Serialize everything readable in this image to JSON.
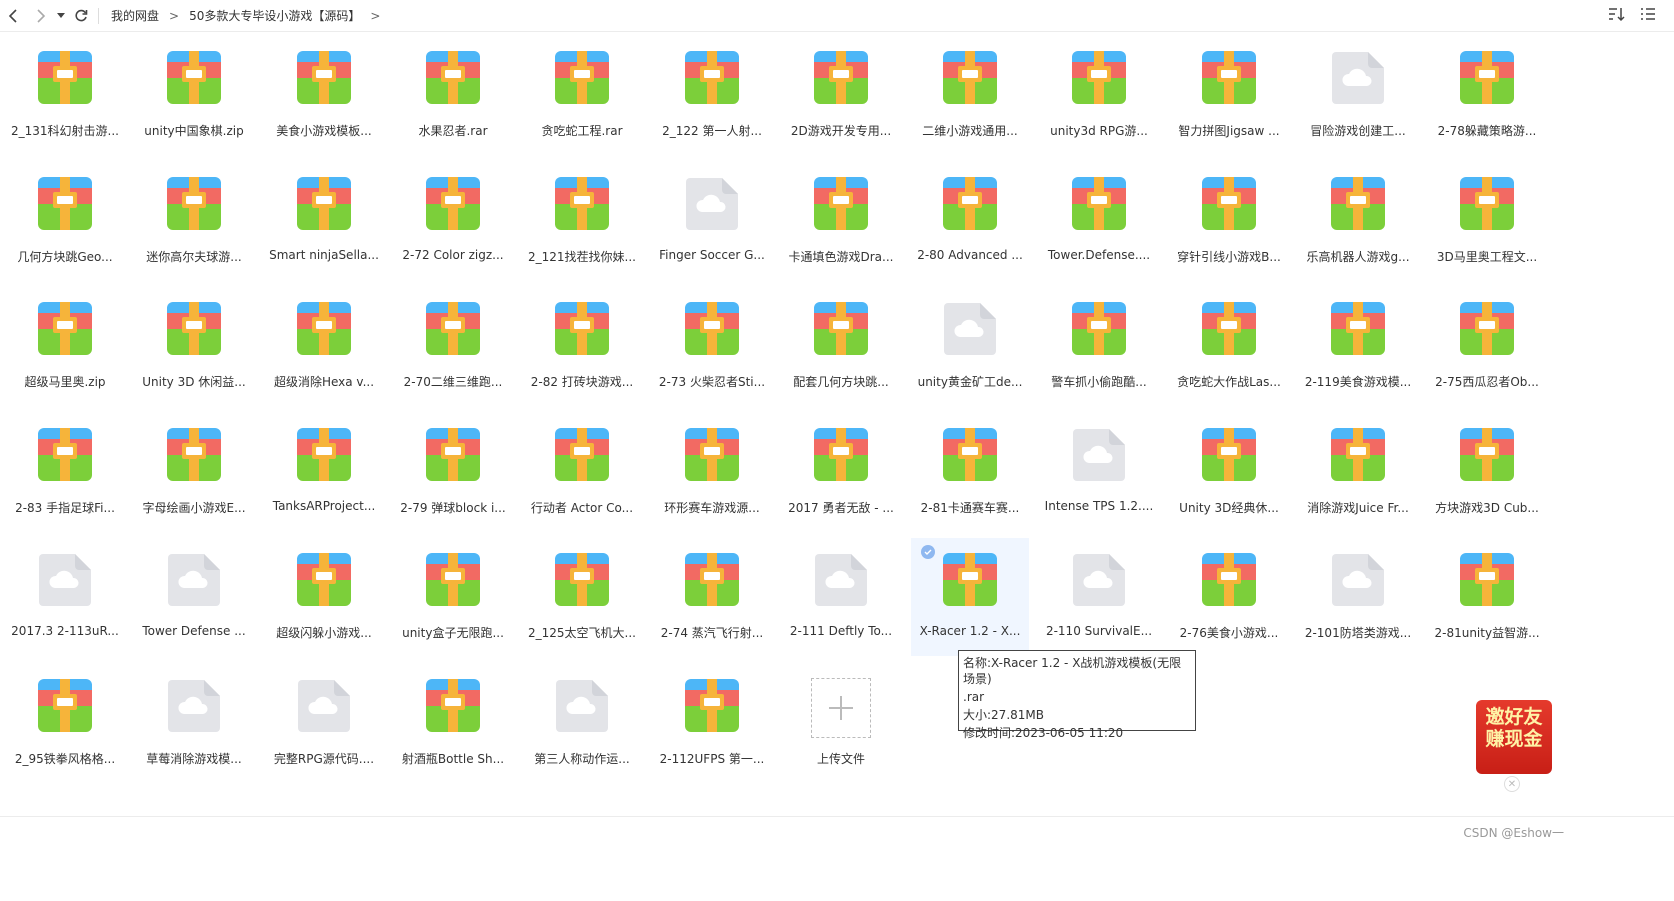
{
  "breadcrumb": {
    "items": [
      "我的网盘",
      "50多款大专毕设小游戏【源码】"
    ],
    "separator": ">"
  },
  "toolbar": {
    "back_icon": "chevron-left-icon",
    "forward_icon": "chevron-right-icon",
    "history_icon": "caret-down-icon",
    "refresh_icon": "refresh-icon",
    "sort_icon": "sort-icon",
    "view_icon": "list-view-icon"
  },
  "files": [
    {
      "name": "2_131科幻射击游...",
      "type": "archive"
    },
    {
      "name": "unity中国象棋.zip",
      "type": "archive"
    },
    {
      "name": "美食小游戏模板...",
      "type": "archive"
    },
    {
      "name": "水果忍者.rar",
      "type": "archive"
    },
    {
      "name": "贪吃蛇工程.rar",
      "type": "archive"
    },
    {
      "name": "2_122 第一人射...",
      "type": "archive"
    },
    {
      "name": "2D游戏开发专用...",
      "type": "archive"
    },
    {
      "name": "二维小游戏通用...",
      "type": "archive"
    },
    {
      "name": "unity3d RPG游...",
      "type": "archive"
    },
    {
      "name": "智力拼图Jigsaw ...",
      "type": "archive"
    },
    {
      "name": "冒险游戏创建工...",
      "type": "cloud"
    },
    {
      "name": "2-78躲藏策略游...",
      "type": "archive"
    },
    {
      "name": "几何方块跳Geo...",
      "type": "archive"
    },
    {
      "name": "迷你高尔夫球游...",
      "type": "archive"
    },
    {
      "name": "Smart ninjaSella...",
      "type": "archive"
    },
    {
      "name": "2-72 Color zigz...",
      "type": "archive"
    },
    {
      "name": "2_121找茬找你妹...",
      "type": "archive"
    },
    {
      "name": "Finger Soccer G...",
      "type": "cloud"
    },
    {
      "name": "卡通填色游戏Dra...",
      "type": "archive"
    },
    {
      "name": "2-80 Advanced ...",
      "type": "archive"
    },
    {
      "name": "Tower.Defense....",
      "type": "archive"
    },
    {
      "name": "穿针引线小游戏B...",
      "type": "archive"
    },
    {
      "name": "乐高机器人游戏g...",
      "type": "archive"
    },
    {
      "name": "3D马里奥工程文...",
      "type": "archive"
    },
    {
      "name": "超级马里奥.zip",
      "type": "archive"
    },
    {
      "name": "Unity 3D 休闲益...",
      "type": "archive"
    },
    {
      "name": "超级消除Hexa v...",
      "type": "archive"
    },
    {
      "name": "2-70二维三维跑...",
      "type": "archive"
    },
    {
      "name": "2-82 打砖块游戏...",
      "type": "archive"
    },
    {
      "name": "2-73 火柴忍者Sti...",
      "type": "archive"
    },
    {
      "name": "配套几何方块跳...",
      "type": "archive"
    },
    {
      "name": "unity黄金矿工de...",
      "type": "cloud"
    },
    {
      "name": "警车抓小偷跑酷...",
      "type": "archive"
    },
    {
      "name": "贪吃蛇大作战Las...",
      "type": "archive"
    },
    {
      "name": "2-119美食游戏模...",
      "type": "archive"
    },
    {
      "name": "2-75西瓜忍者Ob...",
      "type": "archive"
    },
    {
      "name": "2-83 手指足球Fi...",
      "type": "archive"
    },
    {
      "name": "字母绘画小游戏E...",
      "type": "archive"
    },
    {
      "name": "TanksARProject...",
      "type": "archive"
    },
    {
      "name": "2-79 弹球block i...",
      "type": "archive"
    },
    {
      "name": "行动者 Actor Co...",
      "type": "archive"
    },
    {
      "name": "环形赛车游戏源...",
      "type": "archive"
    },
    {
      "name": "2017 勇者无敌 - ...",
      "type": "archive"
    },
    {
      "name": "2-81卡通赛车赛...",
      "type": "archive"
    },
    {
      "name": "Intense TPS 1.2....",
      "type": "cloud"
    },
    {
      "name": "Unity 3D经典休...",
      "type": "archive"
    },
    {
      "name": "消除游戏Juice Fr...",
      "type": "archive"
    },
    {
      "name": "方块游戏3D Cub...",
      "type": "archive"
    },
    {
      "name": "2017.3 2-113uR...",
      "type": "cloud"
    },
    {
      "name": "Tower Defense ...",
      "type": "cloud"
    },
    {
      "name": "超级闪躲小游戏...",
      "type": "archive"
    },
    {
      "name": "unity盒子无限跑...",
      "type": "archive"
    },
    {
      "name": "2_125太空飞机大...",
      "type": "archive"
    },
    {
      "name": "2-74 蒸汽飞行射...",
      "type": "archive"
    },
    {
      "name": "2-111 Deftly To...",
      "type": "cloud"
    },
    {
      "name": "X-Racer 1.2 - X...",
      "type": "archive",
      "selected": true
    },
    {
      "name": "2-110 SurvivalE...",
      "type": "cloud"
    },
    {
      "name": "2-76美食小游戏...",
      "type": "archive"
    },
    {
      "name": "2-101防塔类游戏...",
      "type": "cloud"
    },
    {
      "name": "2-81unity益智游...",
      "type": "archive"
    },
    {
      "name": "2_95铁拳风格格...",
      "type": "archive"
    },
    {
      "name": "草莓消除游戏模...",
      "type": "cloud"
    },
    {
      "name": "完整RPG源代码....",
      "type": "cloud"
    },
    {
      "name": "射酒瓶Bottle Sh...",
      "type": "archive"
    },
    {
      "name": "第三人称动作运...",
      "type": "cloud"
    },
    {
      "name": "2-112UFPS 第一...",
      "type": "archive"
    },
    {
      "name": "上传文件",
      "type": "upload"
    }
  ],
  "tooltip": {
    "name_line": "名称:X-Racer 1.2 - X战机游戏模板(无限场景)",
    "ext_line": ".rar",
    "size_line": "大小:27.81MB",
    "time_line": "修改时间:2023-06-05 11:20"
  },
  "promo": {
    "line1": "邀好友",
    "line2": "赚现金"
  },
  "watermark": "CSDN @Eshow一",
  "colors": {
    "archive_top": "#4db6f7",
    "archive_red": "#f26a63",
    "archive_green": "#7ccf3a",
    "archive_belt": "#f6b43a",
    "cloud_bg": "#e3e4e8",
    "selected_bg": "#f0f6ff"
  }
}
